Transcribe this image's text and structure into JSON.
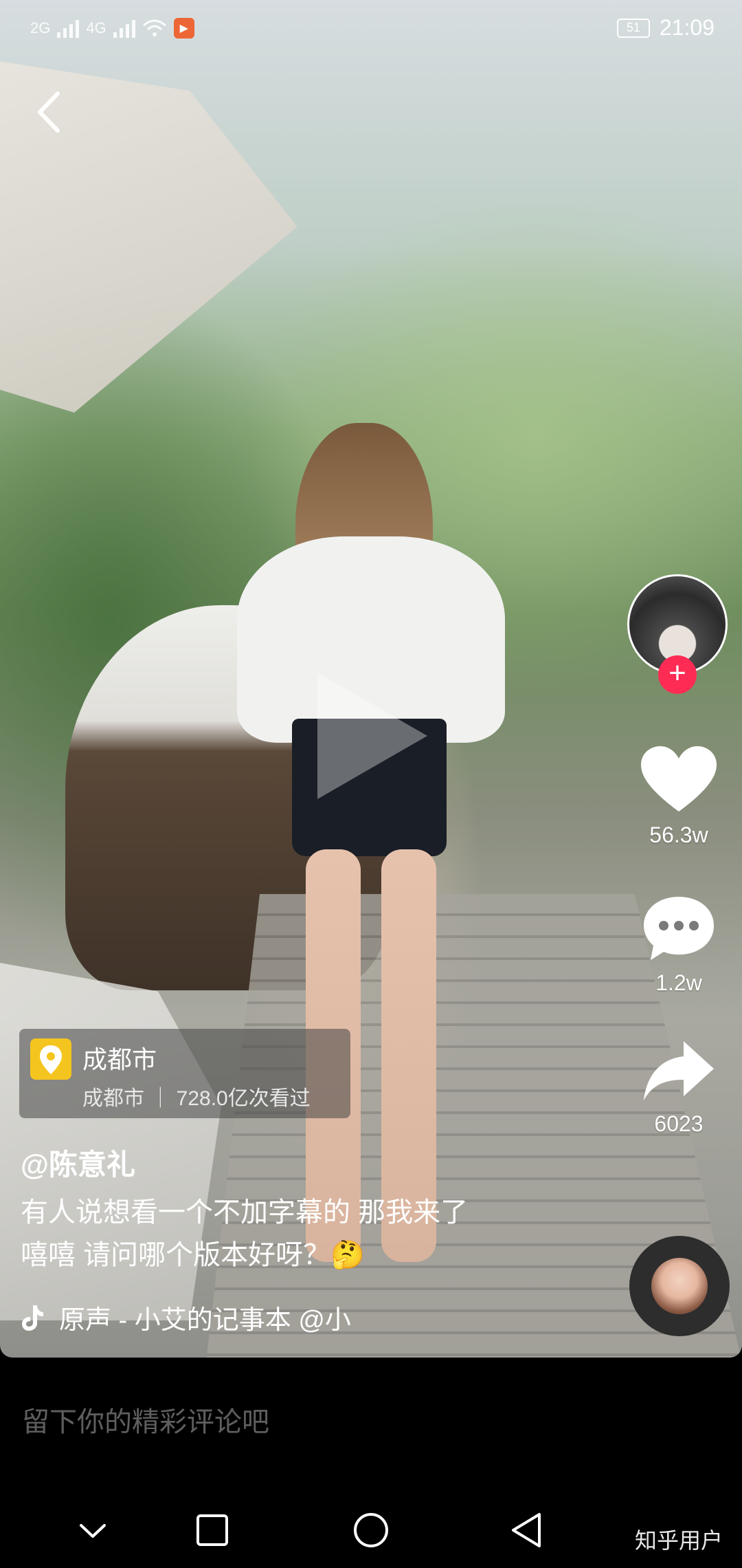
{
  "status_bar": {
    "network1": "2G",
    "network2": "4G",
    "battery": "51",
    "time": "21:09"
  },
  "video": {
    "author": "@陈意礼",
    "caption_line1": "有人说想看一个不加字幕的 那我来了",
    "caption_line2": "嘻嘻  请问哪个版本好呀？🤔",
    "music": "原声 - 小艾的记事本    @小"
  },
  "location": {
    "city": "成都市",
    "subtitle": "成都市  ｜  728.0亿次看过"
  },
  "actions": {
    "like_count": "56.3w",
    "comment_count": "1.2w",
    "share_count": "6023"
  },
  "comment_bar": {
    "placeholder": "留下你的精彩评论吧"
  },
  "watermark": "知乎用户",
  "colors": {
    "follow_accent": "#fe2c55",
    "location_badge": "#f5c51f",
    "app_badge": "#f05a24"
  }
}
